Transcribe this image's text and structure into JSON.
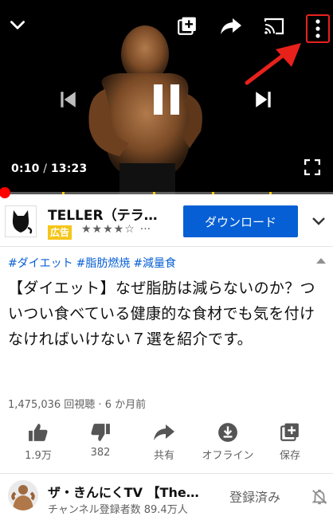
{
  "player": {
    "current_time": "0:10",
    "separator": " / ",
    "duration": "13:23",
    "progress_fraction": 0.012,
    "icons": {
      "minimize": "chevron-down-icon",
      "add_to_playlist": "add-to-playlist-icon",
      "share": "share-icon",
      "cast": "cast-icon",
      "more": "more-vert-icon",
      "previous": "skip-previous-icon",
      "play_pause": "pause-icon",
      "next": "skip-next-icon",
      "fullscreen": "fullscreen-icon"
    }
  },
  "ad": {
    "title": "TELLER（テラ…",
    "badge": "広告",
    "stars": "★★★★☆",
    "rating_dots": "···",
    "cta_label": "ダウンロード"
  },
  "video": {
    "hashtags": [
      "#ダイエット",
      "#脂肪燃焼",
      "#減量食"
    ],
    "title": "【ダイエット】なぜ脂肪は減らないのか？ついつい食べている健康的な食材でも気を付けなければいけない７選を紹介です。",
    "views": "1,475,036 回視聴",
    "meta_sep": " · ",
    "age": "6 か月前"
  },
  "actions": [
    {
      "label": "1.9万",
      "icon": "thumbs-up-icon"
    },
    {
      "label": "382",
      "icon": "thumbs-down-icon"
    },
    {
      "label": "共有",
      "icon": "share-icon"
    },
    {
      "label": "オフライン",
      "icon": "download-icon"
    },
    {
      "label": "保存",
      "icon": "add-to-playlist-icon"
    }
  ],
  "channel": {
    "name": "ザ・きんにくTV 【The…",
    "subscribers": "チャンネル登録者数 89.4万人",
    "subscribe_state": "登録済み"
  },
  "colors": {
    "accent_blue": "#065fd4",
    "progress_red": "#ff0000",
    "ad_badge": "#f5c518",
    "annotation_red": "#e8211b"
  }
}
